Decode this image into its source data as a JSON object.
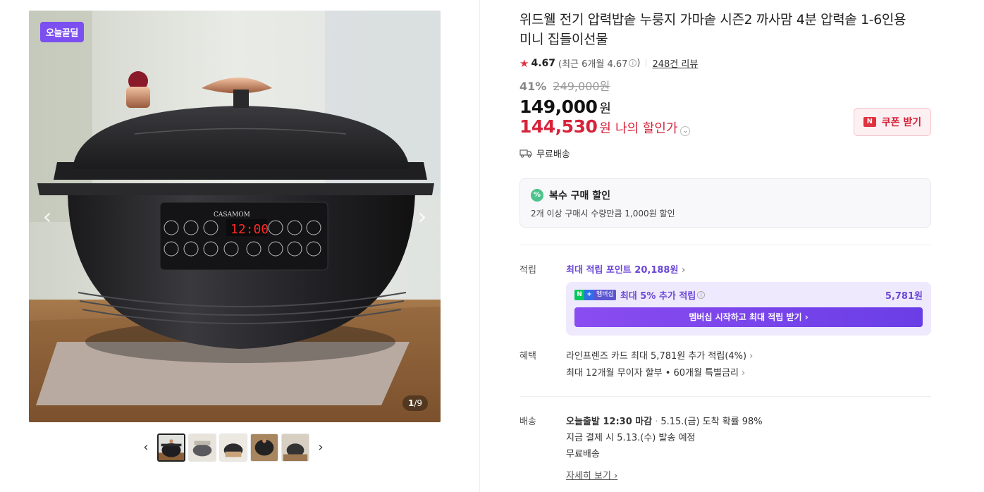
{
  "gallery": {
    "badge": "오늘끝딜",
    "counter_current": "1",
    "counter_total": "/9",
    "prev_icon": "‹",
    "next_icon": "›",
    "thumb_prev": "‹",
    "thumb_next": "›",
    "product_logo": "CASAMOM",
    "product_display": "12:00"
  },
  "product": {
    "title": "위드웰 전기 압력밥솥 누룽지 가마솥 시즌2 까사맘 4분 압력솥 1-6인용 미니 집들이선물",
    "rating": "4.67",
    "rating_recent": "(최근 6개월 4.67",
    "rating_recent_close": ")",
    "reviews": "248건 리뷰",
    "discount_pct": "41%",
    "original_price": "249,000원",
    "price": "149,000",
    "price_unit": "원",
    "my_price": "144,530",
    "my_price_unit": "원",
    "my_price_label": "나의 할인가",
    "coupon_label": "쿠폰 받기",
    "shipping": "무료배송"
  },
  "multi_discount": {
    "title": "복수 구매 할인",
    "desc": "2개 이상 구매시 수량만큼 1,000원 할인"
  },
  "points": {
    "label": "적립",
    "max_point": "최대 적립 포인트 20,188원",
    "member_tag": "멤버십",
    "member_text": "최대 5% 추가 적립",
    "member_amount": "5,781원",
    "member_button": "멤버십 시작하고 최대 적립 받기 ›"
  },
  "benefits": {
    "label": "혜택",
    "lines": [
      "라인프렌즈 카드 최대 5,781원 추가 적립(4%)",
      "최대 12개월 무이자 할부 • 60개월 특별금리"
    ]
  },
  "delivery": {
    "label": "배송",
    "today": "오늘출발 12:30 마감",
    "arrival": "5.15.(금) 도착 확률 98%",
    "ship_note": "지금 결제 시 5.13.(수) 발송 예정",
    "fee": "무료배송",
    "detail": "자세히 보기"
  },
  "colors": {
    "accent_purple": "#6b47d6",
    "sale_red": "#d6233a",
    "deal_badge": "#7b4ff0"
  }
}
